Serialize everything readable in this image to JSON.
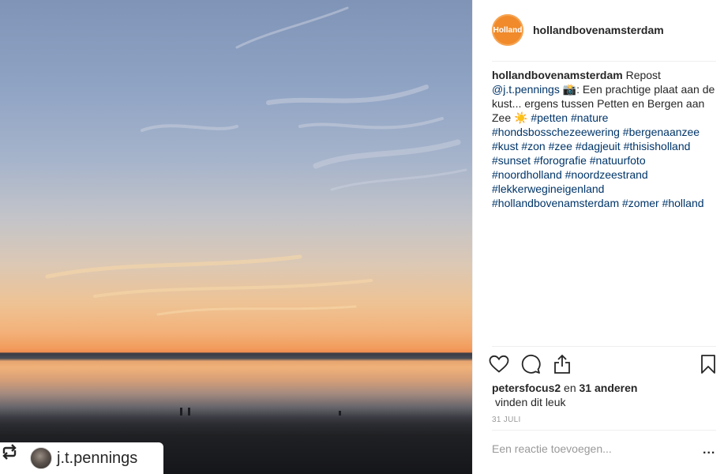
{
  "photo": {
    "alt": "",
    "repost_username": "j.t.pennings",
    "icons": {
      "repost": "repost-arrows-icon",
      "avatar": "user-avatar"
    }
  },
  "header": {
    "logo_text": "Holland",
    "username": "hollandbovenamsterdam"
  },
  "caption": {
    "username": "hollandbovenamsterdam",
    "intro": " Repost",
    "mention": "@j.t.pennings",
    "emoji1": " 📸",
    "text1": ": Een prachtige plaat aan de kust... ergens tussen Petten en Bergen aan Zee ",
    "emoji2": "☀️",
    "hashtags": [
      "#petten",
      "#nature",
      "#hondsbosschezeewering",
      "#bergenaanzee",
      "#kust",
      "#zon",
      "#zee",
      "#dagjeuit",
      "#thisisholland",
      "#sunset",
      "#forografie",
      "#natuurfoto",
      "#noordholland",
      "#noordzeestrand",
      "#lekkerwegineigenland",
      "#hollandbovenamsterdam",
      "#zomer",
      "#holland"
    ]
  },
  "actions": {
    "like": "heart-icon",
    "comment": "comment-bubble-icon",
    "share": "share-icon",
    "save": "bookmark-icon"
  },
  "likes": {
    "user": "petersfocus2",
    "mid": " en ",
    "others": "31 anderen",
    "line2": "vinden dit leuk"
  },
  "date": "31 JULI",
  "comment_box": {
    "placeholder": "Een reactie toevoegen...",
    "more": "..."
  }
}
